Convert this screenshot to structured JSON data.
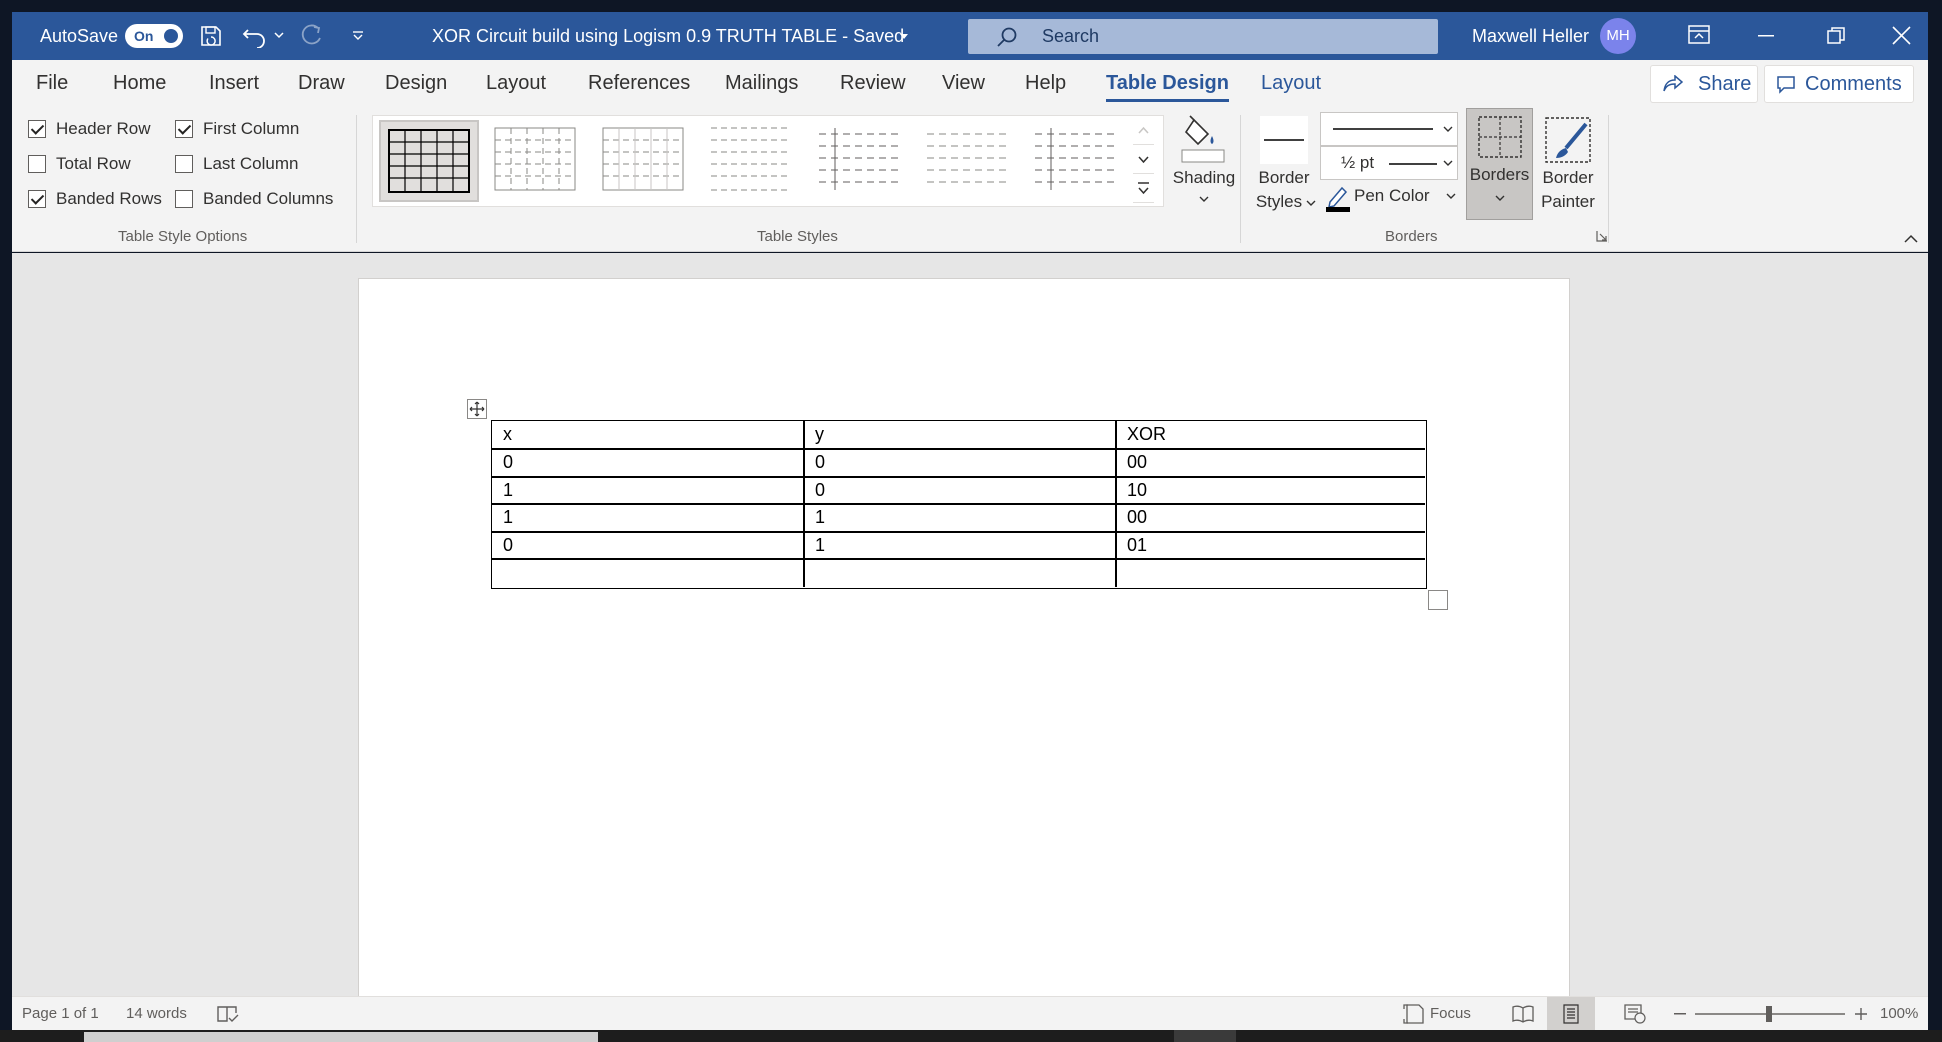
{
  "titlebar": {
    "autosave_label": "AutoSave",
    "autosave_state": "On",
    "doc_title": "XOR Circuit build using Logism 0.9 TRUTH TABLE  -  Saved",
    "search_placeholder": "Search",
    "user_name": "Maxwell Heller",
    "user_initials": "MH"
  },
  "menu": {
    "tabs": [
      "File",
      "Home",
      "Insert",
      "Draw",
      "Design",
      "Layout",
      "References",
      "Mailings",
      "Review",
      "View",
      "Help",
      "Table Design",
      "Layout"
    ],
    "active_tab": "Table Design",
    "share_label": "Share",
    "comments_label": "Comments"
  },
  "ribbon": {
    "style_options": {
      "header_row": {
        "label": "Header Row",
        "checked": true
      },
      "total_row": {
        "label": "Total Row",
        "checked": false
      },
      "banded_rows": {
        "label": "Banded Rows",
        "checked": true
      },
      "first_column": {
        "label": "First Column",
        "checked": true
      },
      "last_column": {
        "label": "Last Column",
        "checked": false
      },
      "banded_columns": {
        "label": "Banded Columns",
        "checked": false
      },
      "group_label": "Table Style Options"
    },
    "table_styles": {
      "group_label": "Table Styles",
      "shading_label": "Shading"
    },
    "borders": {
      "group_label": "Borders",
      "border_styles_line1": "Border",
      "border_styles_line2": "Styles",
      "pen_weight": "½ pt",
      "pen_color_label": "Pen Color",
      "borders_label": "Borders",
      "border_painter_line1": "Border",
      "border_painter_line2": "Painter"
    },
    "colors": {
      "accent": "#2b579a",
      "pen": "#000000"
    }
  },
  "table": {
    "headers": [
      "x",
      "y",
      "XOR"
    ],
    "rows": [
      [
        "0",
        "0",
        "00"
      ],
      [
        "1",
        "0",
        "10"
      ],
      [
        "1",
        "1",
        "00"
      ],
      [
        "0",
        "1",
        "01"
      ],
      [
        "",
        "",
        ""
      ]
    ]
  },
  "statusbar": {
    "page": "Page 1 of 1",
    "words": "14 words",
    "focus_label": "Focus",
    "zoom": "100%"
  }
}
